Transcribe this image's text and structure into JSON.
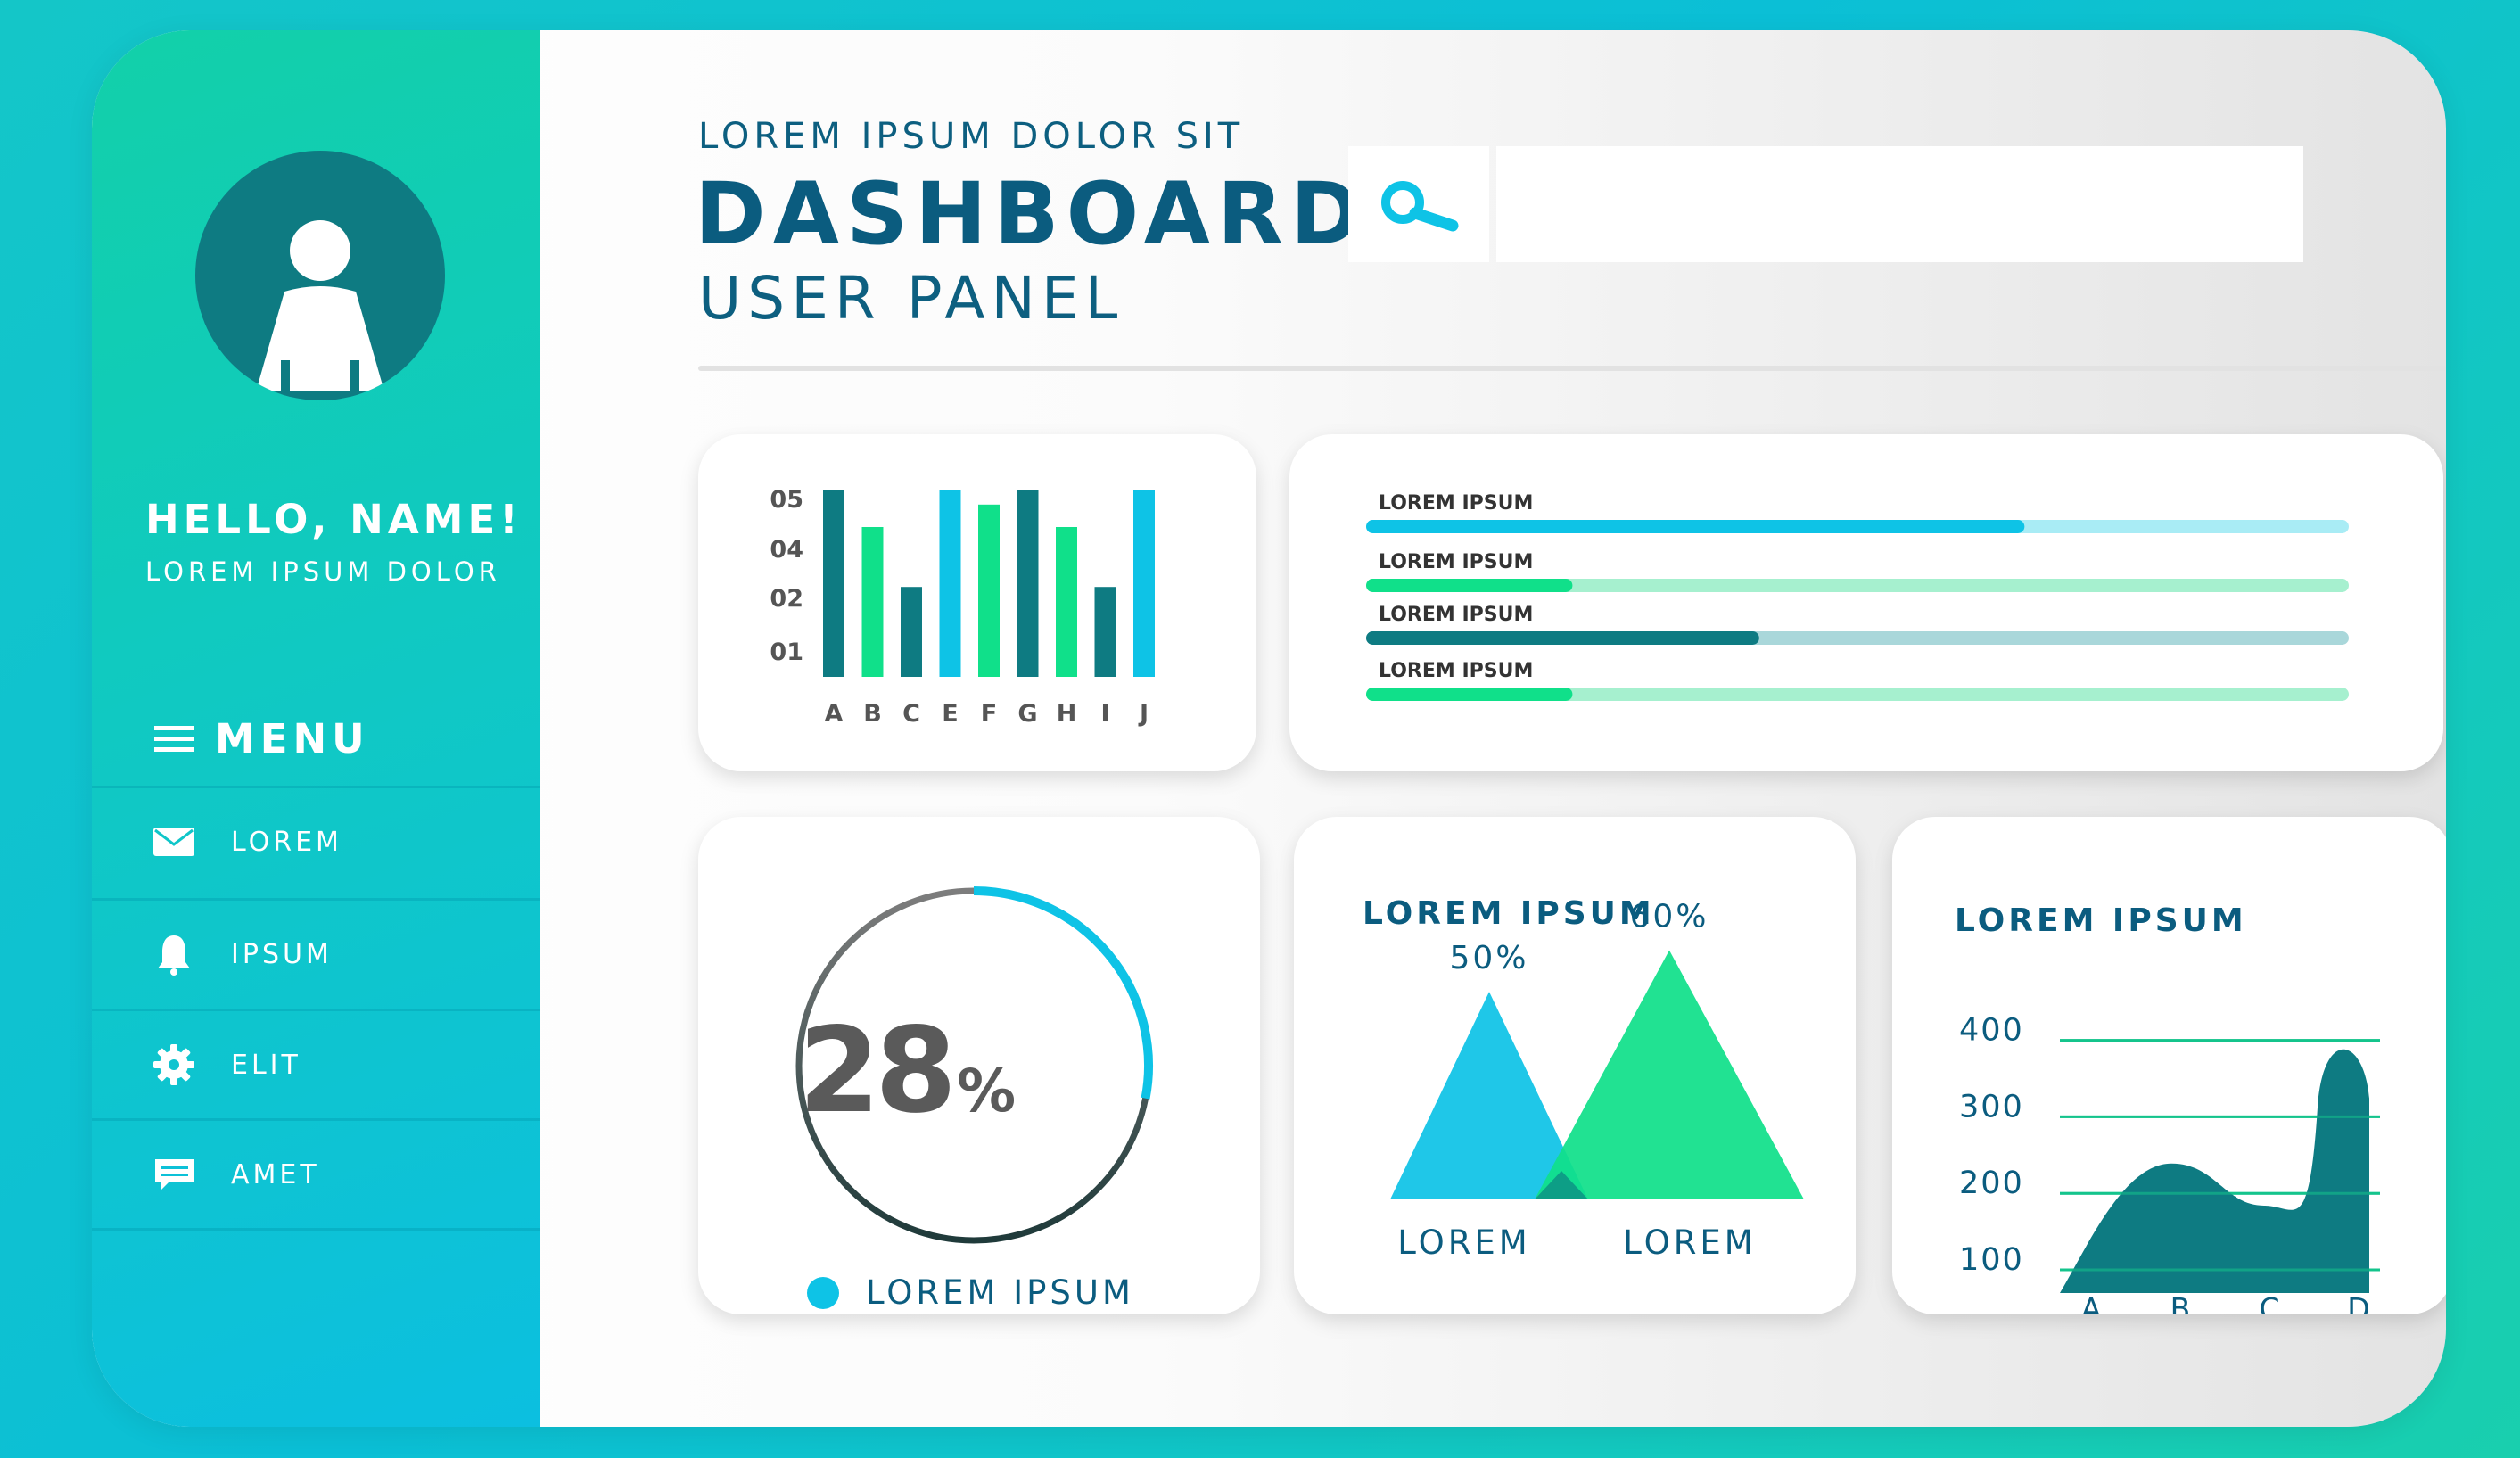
{
  "colors": {
    "teal_dark": "#0e7b82",
    "cyan": "#0ec3e6",
    "green": "#10e08a",
    "navy_text": "#0b5c7f"
  },
  "sidebar": {
    "greeting": "HELLO, NAME!",
    "subgreeting": "LOREM IPSUM DOLOR",
    "menu_title": "MENU",
    "items": [
      {
        "label": "LOREM",
        "icon": "mail-icon"
      },
      {
        "label": "IPSUM",
        "icon": "bell-icon"
      },
      {
        "label": "ELIT",
        "icon": "gear-icon"
      },
      {
        "label": "AMET",
        "icon": "chat-icon"
      }
    ]
  },
  "header": {
    "kicker": "LOREM IPSUM DOLOR SIT",
    "title": "DASHBOARD",
    "subtitle": "USER PANEL"
  },
  "search": {
    "value": "",
    "icon": "search-icon"
  },
  "progress_card": {
    "bars": [
      {
        "label": "LOREM IPSUM",
        "value": 0.67,
        "color": "#0ec3e6",
        "track": "#a9ecf5"
      },
      {
        "label": "LOREM IPSUM",
        "value": 0.21,
        "color": "#10e08a",
        "track": "#a6f0cf"
      },
      {
        "label": "LOREM IPSUM",
        "value": 0.4,
        "color": "#0e7b82",
        "track": "#a9d7da"
      },
      {
        "label": "LOREM IPSUM",
        "value": 0.21,
        "color": "#10e08a",
        "track": "#a6f0cf"
      }
    ]
  },
  "donut_card": {
    "value_text": "28",
    "unit": "%",
    "percent": 28,
    "legend_label": "LOREM IPSUM",
    "legend_color": "#0ec3e6"
  },
  "chart_data": [
    {
      "type": "bar",
      "categories": [
        "A",
        "B",
        "C",
        "E",
        "F",
        "G",
        "H",
        "I",
        "J"
      ],
      "y_tick_labels": [
        "05",
        "04",
        "02",
        "01"
      ],
      "ylim": [
        0,
        5
      ],
      "values": [
        5.0,
        4.0,
        2.4,
        5.0,
        4.6,
        5.0,
        4.0,
        2.4,
        5.0
      ],
      "colors": [
        "#0e7b82",
        "#10e08a",
        "#0e7b82",
        "#0ec3e6",
        "#10e08a",
        "#0e7b82",
        "#10e08a",
        "#0e7b82",
        "#0ec3e6"
      ]
    },
    {
      "type": "area",
      "title": "LOREM IPSUM",
      "categories": [
        "LOREM",
        "LOREM"
      ],
      "values": [
        50,
        60
      ],
      "data_labels": [
        "50%",
        "60%"
      ],
      "colors": [
        "#0ec3e6",
        "#10e08a"
      ],
      "ylim": [
        0,
        70
      ]
    },
    {
      "type": "area",
      "title": "LOREM IPSUM",
      "x": [
        "A",
        "B",
        "C",
        "D"
      ],
      "y_ticks": [
        100,
        200,
        300,
        400
      ],
      "ylim": [
        70,
        410
      ],
      "values": [
        95,
        225,
        170,
        380
      ],
      "color": "#0e7b82",
      "grid": true
    }
  ]
}
